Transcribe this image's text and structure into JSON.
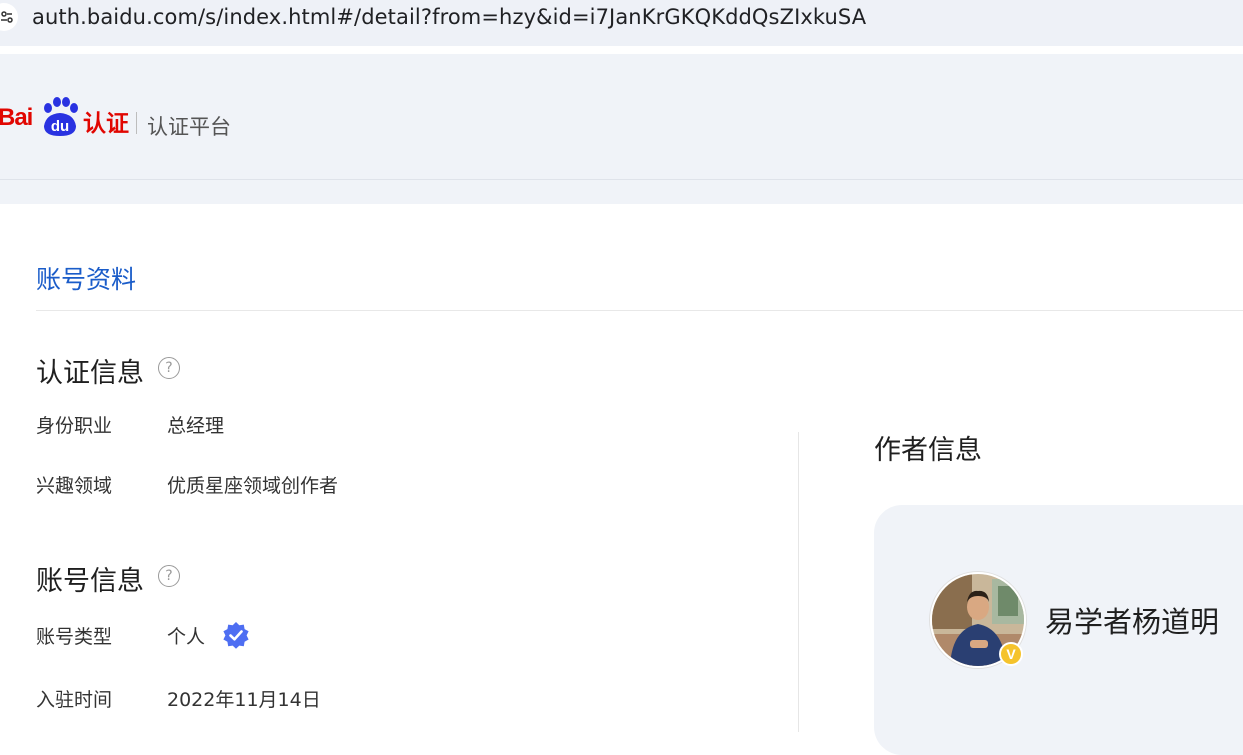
{
  "browser": {
    "url": "auth.baidu.com/s/index.html#/detail?from=hzy&id=i7JanKrGKQKddQsZIxkuSA"
  },
  "header": {
    "logo_bai": "Bai",
    "logo_du": "du",
    "logo_renzheng": "认证",
    "platform_title": "认证平台"
  },
  "page": {
    "tab_label": "账号资料"
  },
  "cert_info": {
    "title": "认证信息",
    "help": "?",
    "rows": [
      {
        "label": "身份职业",
        "value": "总经理"
      },
      {
        "label": "兴趣领域",
        "value": "优质星座领域创作者"
      }
    ]
  },
  "account_info": {
    "title": "账号信息",
    "help": "?",
    "rows": [
      {
        "label": "账号类型",
        "value": "个人"
      },
      {
        "label": "入驻时间",
        "value": "2022年11月14日"
      }
    ]
  },
  "author": {
    "title": "作者信息",
    "name": "易学者杨道明",
    "badge": "V"
  },
  "colors": {
    "accent_blue": "#1a5cc9",
    "baidu_red": "#e10601",
    "baidu_blue": "#2932e1",
    "verified_blue": "#4e6ef2",
    "badge_gold": "#f5c32c"
  }
}
